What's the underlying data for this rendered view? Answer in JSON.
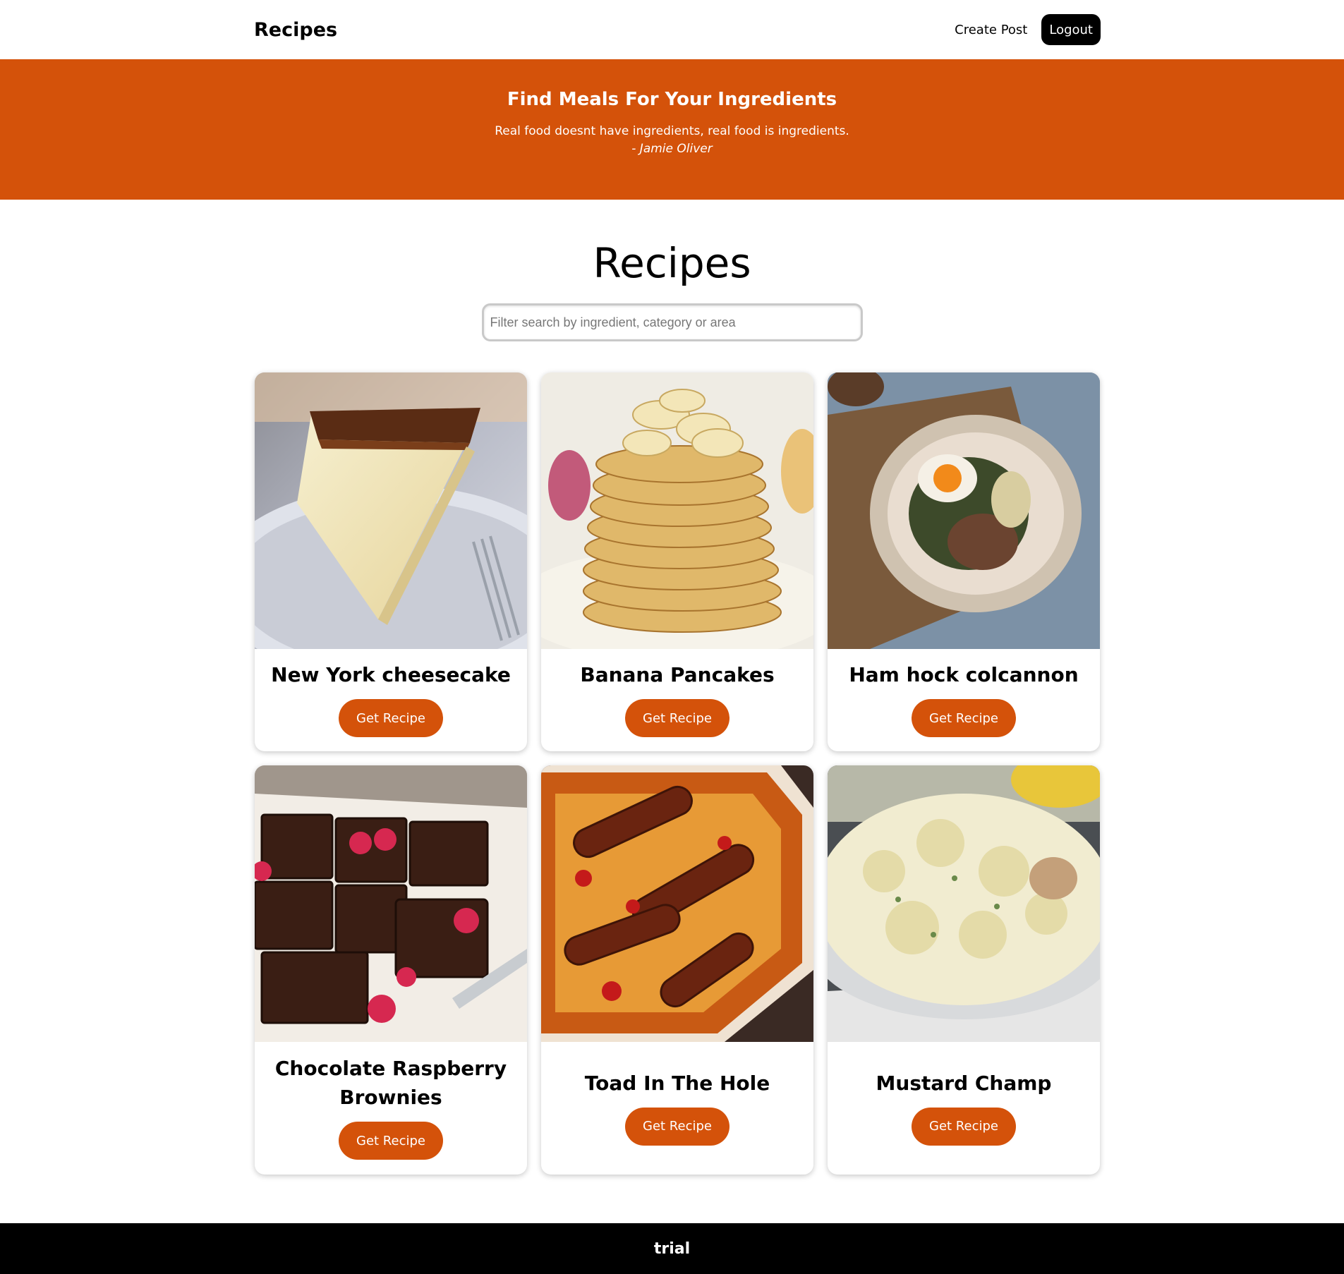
{
  "navbar": {
    "brand": "Recipes",
    "create_post": "Create Post",
    "logout": "Logout"
  },
  "hero": {
    "title": "Find Meals For Your Ingredients",
    "quote": "Real food doesnt have ingredients, real food is ingredients.",
    "author": "- Jamie Oliver",
    "background_color": "#d4520a"
  },
  "main": {
    "title": "Recipes",
    "search": {
      "placeholder": "Filter search by ingredient, category or area",
      "value": ""
    }
  },
  "recipes": [
    {
      "title": "New York cheesecake",
      "button": "Get Recipe",
      "image": "cheesecake-photo"
    },
    {
      "title": "Banana Pancakes",
      "button": "Get Recipe",
      "image": "pancakes-photo"
    },
    {
      "title": "Ham hock colcannon",
      "button": "Get Recipe",
      "image": "colcannon-photo"
    },
    {
      "title": "Chocolate Raspberry Brownies",
      "button": "Get Recipe",
      "image": "brownies-photo"
    },
    {
      "title": "Toad In The Hole",
      "button": "Get Recipe",
      "image": "toad-in-the-hole-photo"
    },
    {
      "title": "Mustard Champ",
      "button": "Get Recipe",
      "image": "mustard-champ-photo"
    }
  ],
  "footer": {
    "text": "trial"
  },
  "colors": {
    "accent": "#d4520a",
    "footer_bg": "#000000",
    "logout_bg": "#000000"
  }
}
